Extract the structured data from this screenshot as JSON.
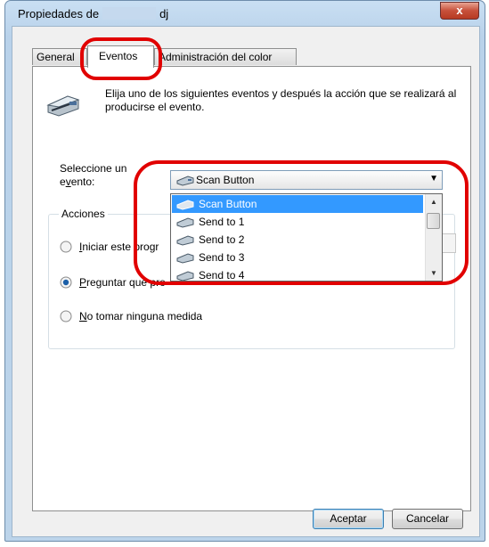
{
  "window": {
    "title_prefix": "Propiedades de",
    "title_suffix": "dj",
    "close_glyph": "x"
  },
  "tabs": [
    {
      "label": "General",
      "active": false
    },
    {
      "label": "Eventos",
      "active": true
    },
    {
      "label": "Administración del color",
      "active": false
    }
  ],
  "events": {
    "description": "Elija uno de los siguientes eventos y después la acción que se realizará al producirse el evento.",
    "select_label": "Seleccione un evento:",
    "selected_event": "Scan Button",
    "options": [
      "Scan Button",
      "Send to 1",
      "Send to 2",
      "Send to 3",
      "Send to 4"
    ]
  },
  "actions": {
    "group_label": "Acciones",
    "options": [
      {
        "label": "Iniciar este programa",
        "checked": false
      },
      {
        "label": "Preguntar qué programa se iniciará",
        "checked": true
      },
      {
        "label": "No tomar ninguna medida",
        "checked": false
      }
    ]
  },
  "buttons": {
    "ok": "Aceptar",
    "cancel": "Cancelar"
  },
  "colors": {
    "highlight": "#e10000",
    "selection": "#3399ff"
  }
}
